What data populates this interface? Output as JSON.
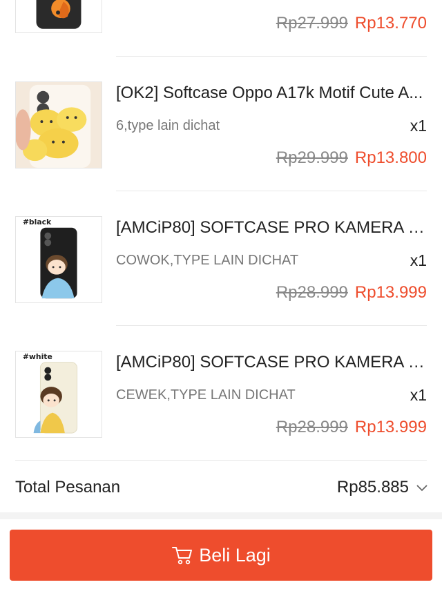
{
  "items": [
    {
      "old_price": "Rp27.999",
      "new_price": "Rp13.770"
    },
    {
      "title": "[OK2] Softcase Oppo A17k Motif Cute A...",
      "variant": "6,type lain dichat",
      "qty": "x1",
      "old_price": "Rp29.999",
      "new_price": "Rp13.800"
    },
    {
      "title": "[AMCiP80] SOFTCASE PRO KAMERA Co...",
      "variant": "COWOK,TYPE LAIN DICHAT",
      "qty": "x1",
      "old_price": "Rp28.999",
      "new_price": "Rp13.999",
      "thumb_tag": "#black"
    },
    {
      "title": "[AMCiP80] SOFTCASE PRO KAMERA Co...",
      "variant": "CEWEK,TYPE LAIN DICHAT",
      "qty": "x1",
      "old_price": "Rp28.999",
      "new_price": "Rp13.999",
      "thumb_tag": "#white"
    }
  ],
  "total": {
    "label": "Total Pesanan",
    "value": "Rp85.885",
    "icon": "chevron-down-icon"
  },
  "cta": {
    "label": "Beli Lagi",
    "icon": "cart-icon"
  },
  "colors": {
    "accent": "#ee4d2d",
    "muted_text": "#777777",
    "strike_text": "#888888"
  }
}
